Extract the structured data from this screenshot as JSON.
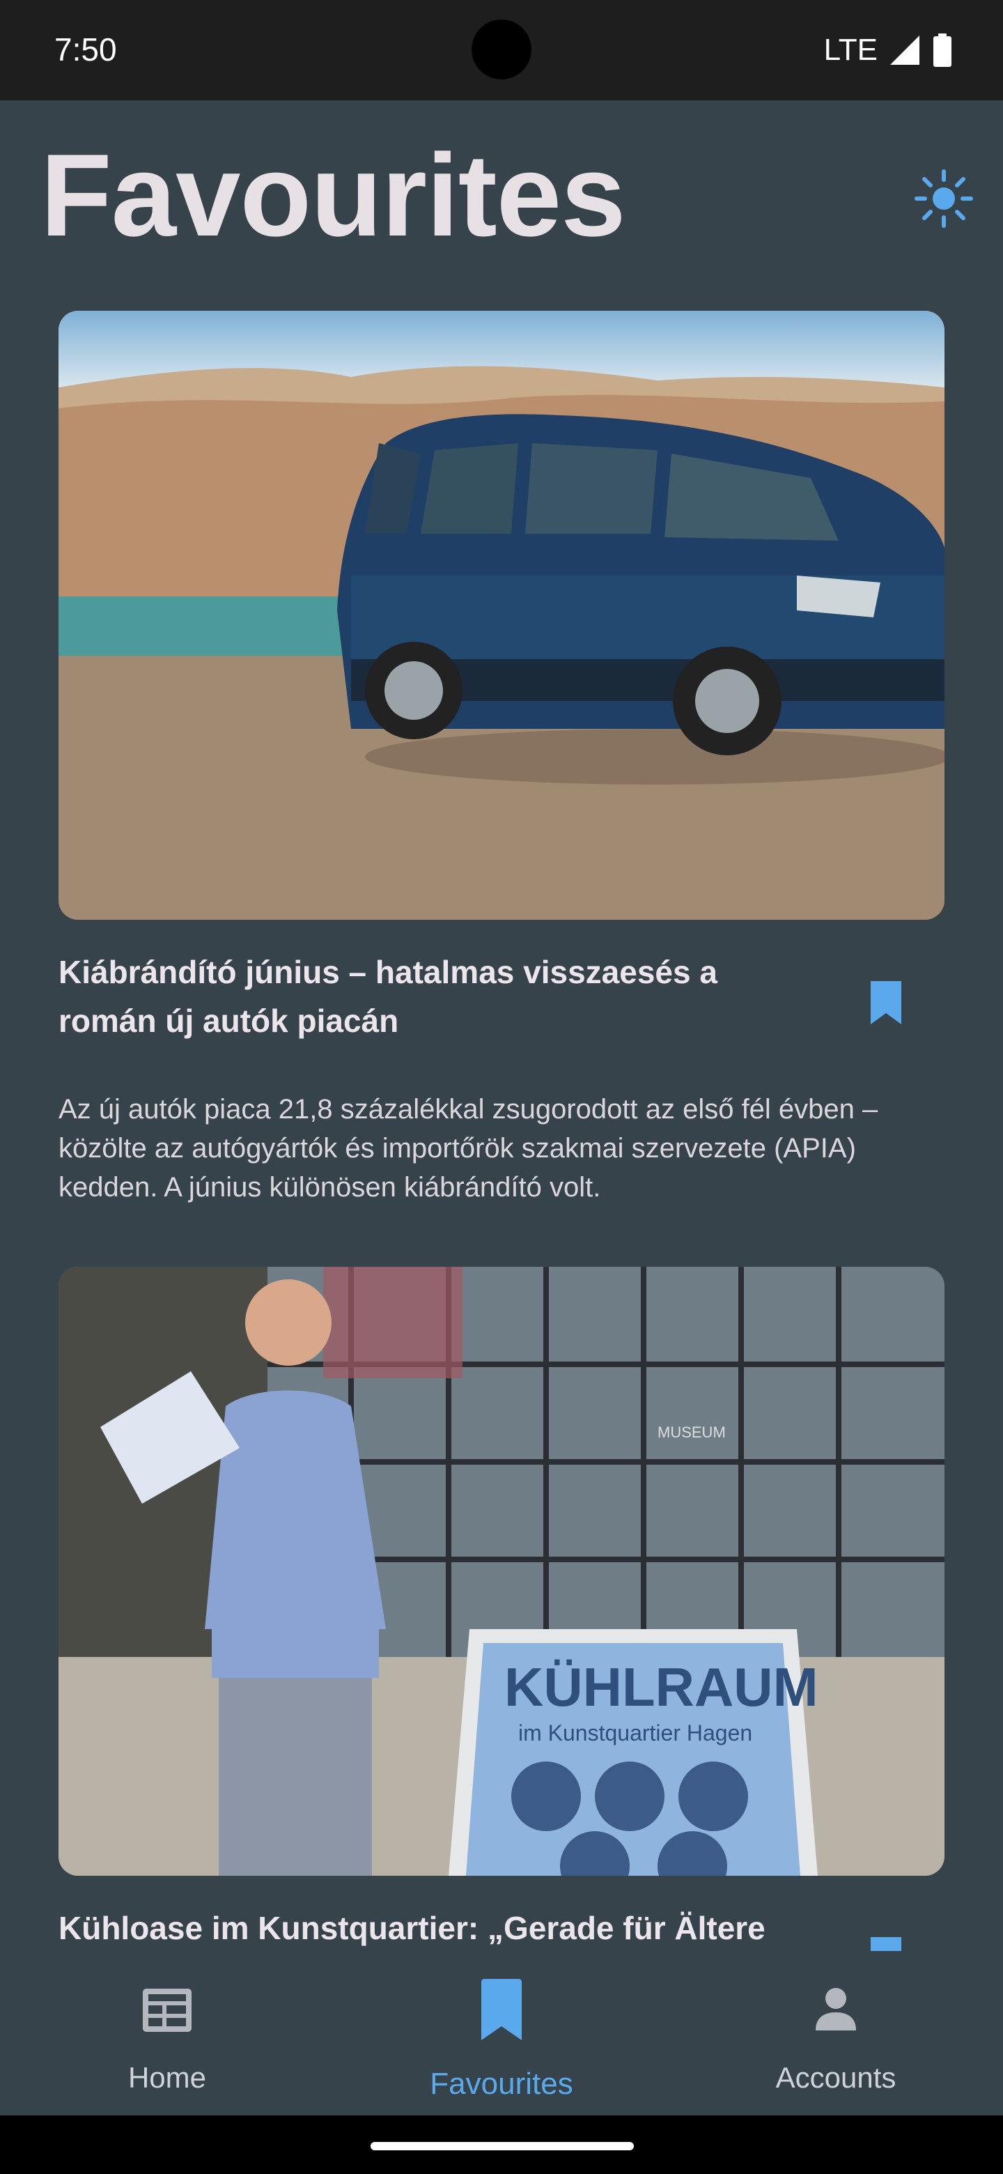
{
  "status_bar": {
    "time": "7:50",
    "network": "LTE"
  },
  "page": {
    "title": "Favourites"
  },
  "articles": [
    {
      "title": "Kiábrándító június – hatalmas visszaesés a román új autók piacán",
      "description": "Az új autók piaca 21,8 százalékkal zsugorodott az első fél évben – közölte az autógyártók és importőrök szakmai szervezete (APIA) kedden. A június különösen kiábrándító volt.",
      "image": "blue minivan parked on rocky ground beside a lake"
    },
    {
      "title": "Kühloase im Kunstquartier: „Gerade für Ältere",
      "image": "smiling man holding fans next to a Kühlraum sign",
      "sign_title": "KÜHLRAUM",
      "sign_subtitle": "im Kunstquartier Hagen",
      "building_sign": "MUSEUM"
    }
  ],
  "nav": {
    "items": [
      {
        "label": "Home",
        "icon": "home-news-icon"
      },
      {
        "label": "Favourites",
        "icon": "bookmark-icon"
      },
      {
        "label": "Accounts",
        "icon": "person-icon"
      }
    ],
    "selected": "Favourites"
  },
  "colors": {
    "accent": "#5aa9ec",
    "background": "#36434b",
    "status_bar": "#1e1e1f"
  }
}
